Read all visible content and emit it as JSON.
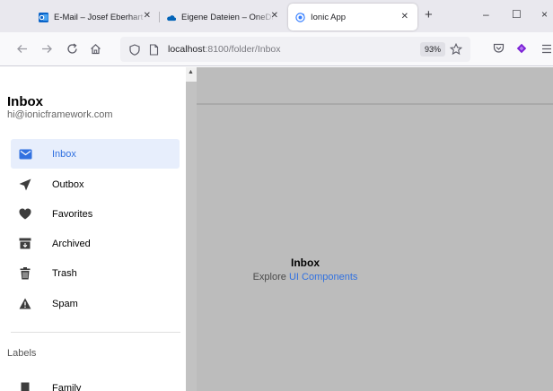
{
  "browser": {
    "tabs": [
      {
        "title": "E-Mail – Josef Eberhart – O",
        "icon": "outlook-icon",
        "active": false
      },
      {
        "title": "Eigene Dateien – OneDrive",
        "icon": "onedrive-cloud-icon",
        "active": false
      },
      {
        "title": "Ionic App",
        "icon": "ionic-icon",
        "active": true
      }
    ],
    "new_tab_label": "+",
    "window_controls": {
      "minimize": "–",
      "maximize": "☐",
      "close": "×"
    },
    "url_host": "localhost",
    "url_rest": ":8100/folder/Inbox",
    "zoom": "93%",
    "colors": {
      "accent": "#3171e0",
      "extension_purple": "#7b1fd6"
    }
  },
  "menu": {
    "title": "Inbox",
    "subtitle": "hi@ionicframework.com",
    "items": [
      {
        "label": "Inbox",
        "icon": "mail-icon",
        "selected": true
      },
      {
        "label": "Outbox",
        "icon": "paper-plane-icon",
        "selected": false
      },
      {
        "label": "Favorites",
        "icon": "heart-icon",
        "selected": false
      },
      {
        "label": "Archived",
        "icon": "archive-icon",
        "selected": false
      },
      {
        "label": "Trash",
        "icon": "trash-icon",
        "selected": false
      },
      {
        "label": "Spam",
        "icon": "warning-icon",
        "selected": false
      }
    ],
    "labels_heading": "Labels",
    "labels": [
      {
        "label": "Family",
        "icon": "bookmark-icon"
      }
    ]
  },
  "content": {
    "title": "Inbox",
    "explore_prefix": "Explore",
    "explore_link": "UI Components"
  }
}
